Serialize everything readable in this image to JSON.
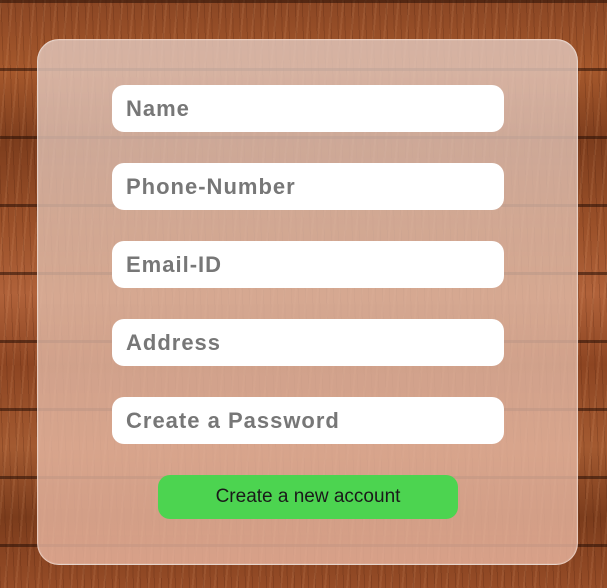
{
  "form": {
    "fields": [
      {
        "placeholder": "Name"
      },
      {
        "placeholder": "Phone-Number"
      },
      {
        "placeholder": "Email-ID"
      },
      {
        "placeholder": "Address"
      },
      {
        "placeholder": "Create a Password"
      }
    ],
    "submit_label": "Create a new account"
  },
  "colors": {
    "submit_button": "#4cd450",
    "field_background": "#ffffff",
    "placeholder_text": "#777777"
  }
}
